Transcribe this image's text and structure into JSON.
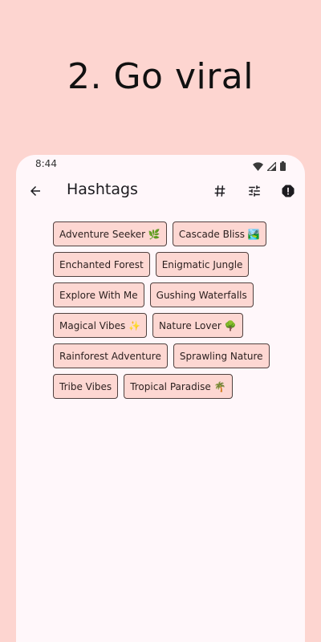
{
  "promo": {
    "title": "2. Go viral"
  },
  "status_bar": {
    "time": "8:44",
    "icons": [
      "wifi-icon",
      "signal-icon",
      "battery-icon"
    ]
  },
  "app_bar": {
    "back_icon": "arrow-back-icon",
    "title": "Hashtags",
    "actions": [
      "hashtag-icon",
      "tune-icon",
      "report-icon"
    ]
  },
  "hashtags": [
    "Adventure Seeker 🌿",
    "Cascade Bliss 🏞️",
    "Enchanted Forest",
    "Enigmatic Jungle",
    "Explore With Me",
    "Gushing Waterfalls",
    "Magical Vibes ✨",
    "Nature Lover 🌳",
    "Rainforest Adventure",
    "Sprawling Nature",
    "Tribe Vibes",
    "Tropical Paradise 🌴"
  ],
  "colors": {
    "background": "#fdd5d0",
    "surface": "#fff7fa",
    "chip_fill": "#fdd7d2",
    "chip_border": "#50413f"
  }
}
